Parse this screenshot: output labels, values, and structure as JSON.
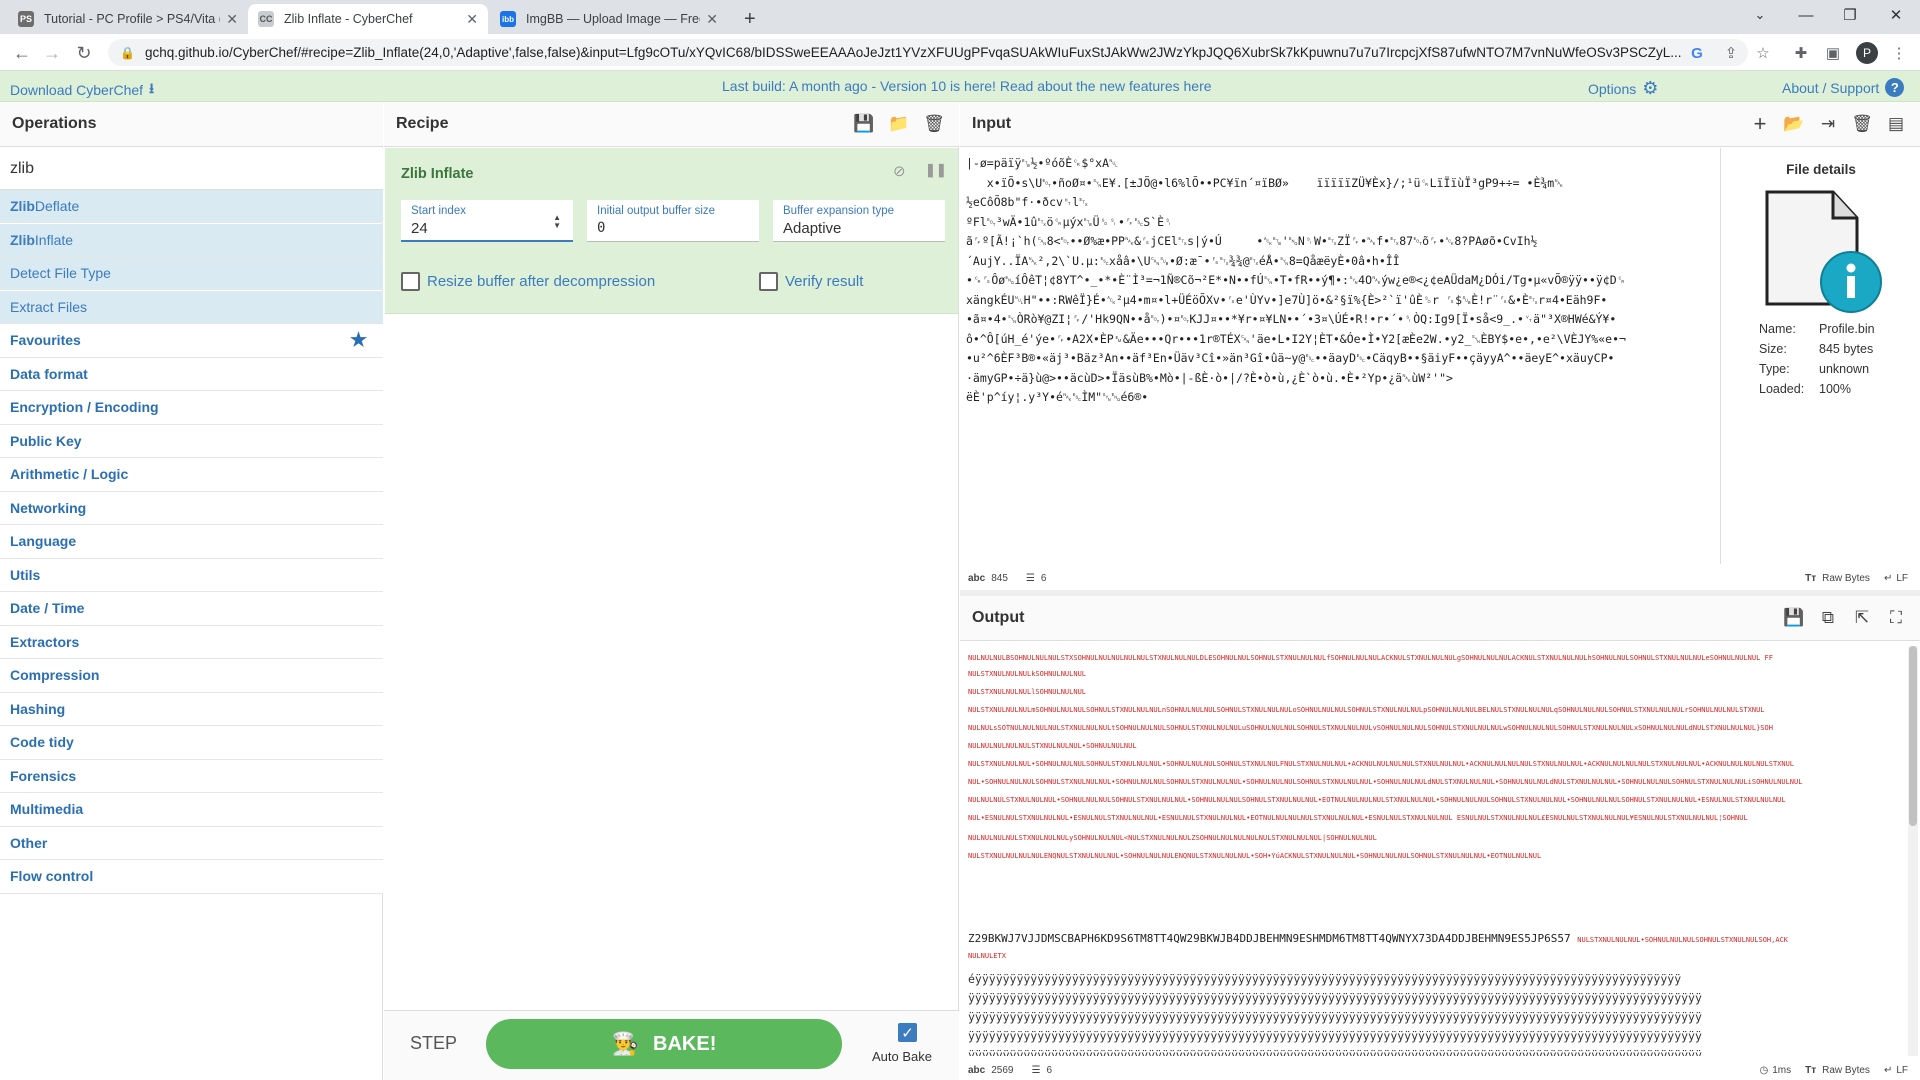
{
  "browser": {
    "tabs": [
      {
        "title": "Tutorial - PC Profile > PS4/Vita (F",
        "favicon": "PS",
        "color": "#6d6d6d"
      },
      {
        "title": "Zlib Inflate - CyberChef",
        "favicon": "CC",
        "color": "#9aa0a6"
      },
      {
        "title": "ImgBB — Upload Image — Free",
        "favicon": "ibb",
        "color": "#1a73e8"
      }
    ],
    "url": "gchq.github.io/CyberChef/#recipe=Zlib_Inflate(24,0,'Adaptive',false,false)&input=Lfg9cOTu/xYQvIC68/bIDSSweEEAAAoJeJzt1YVzXFUUgPFvqaSUAkWIuFuxStJAkWw2JWzYkpJQQ6XubrSk7kKpuwnu7u7u7IrcpcjXfS87ufwNTO7M7vnNuWfeOSv3PSCZyL...",
    "avatar": "P"
  },
  "banner": {
    "download": "Download CyberChef",
    "center": "Last build: A month ago - Version 10 is here! Read about the new features here",
    "options": "Options",
    "about": "About / Support"
  },
  "operations": {
    "title": "Operations",
    "search_value": "zlib",
    "results": [
      {
        "bold": "Zlib",
        "rest": " Deflate"
      },
      {
        "bold": "Zlib",
        "rest": " Inflate"
      },
      {
        "bold": "",
        "rest": "Detect File Type"
      },
      {
        "bold": "",
        "rest": "Extract Files"
      }
    ],
    "categories": [
      "Favourites",
      "Data format",
      "Encryption / Encoding",
      "Public Key",
      "Arithmetic / Logic",
      "Networking",
      "Language",
      "Utils",
      "Date / Time",
      "Extractors",
      "Compression",
      "Hashing",
      "Code tidy",
      "Forensics",
      "Multimedia",
      "Other",
      "Flow control"
    ]
  },
  "recipe": {
    "title": "Recipe",
    "op_name": "Zlib Inflate",
    "fields": [
      {
        "label": "Start index",
        "value": "24"
      },
      {
        "label": "Initial output buffer size",
        "value": "0"
      },
      {
        "label": "Buffer expansion type",
        "value": "Adaptive"
      }
    ],
    "checkboxes": [
      {
        "label": "Resize buffer after decompression",
        "checked": false
      },
      {
        "label": "Verify result",
        "checked": false
      }
    ],
    "step": "STEP",
    "bake": "BAKE!",
    "autobake": "Auto Bake",
    "autobake_checked": true
  },
  "input": {
    "title": "Input",
    "lines": [
      "|-ø=päïÿ␗½•ºóõÈ␍$°xA␀",
      "   x•ïÕ•s\\U␄•ñoØ¤•␖E¥.[±JÕ@•l6%lÕ••PC¥ïn´¤ïBØ»    ïïïïïZÜ¥Èx}/;¹ü␍LïÏïùÏ³gP9+÷= •È¾m␕",
      "½eCôÕ8b\"f·•ðcv␉l␃",
      "ºFl␄³wÄ•1û␃ö␍µýx␗Ü␎␏•␌␛S`È␏",
      "ã␌º[Ã!¡`h(␘8<␄••Ø%æ•PP␕&␜jCEl␃s|ý•Ú     •␆␗'␅N␏W•␃ZÏ␌•␕f•␃87␄õ␌•␆8?PAøõ•CvIh½",
      "´AujY..ÏA␕²,2\\`U.µ:␛xåâ•\\U␘␚•Ø:æ¯•␜␃¾¾@␃éÅ•␖8=QåæëyÈ•0â•h•ÎÎ",
      "•␍␜Ôø␅íÔêT¦¢8YT^•_•*•È¨Ì³=¬1Ñ®Cõ¬²E*•N••fÚ␖•T•fR••ý¶•:␖4O␕ýw¿e®<¿¢eAÜdaM¿DÓi/Tg•µ«vÕ®ÿÿ••ÿ¢D␍",
      "xängkÉU␀H\"••:RWêÏ}É•␆²µ4•m¤•l+ÜÉöÕXv•␜e'ÙYv•]e7Ù]ö•&²§ï%{È>²`ï'ûÈ␎r ␜$␚È!r¨␜&•È␃r¤4•Eäh9F•",
      "•ã¤•4•␖ÒRò¥@ZI¦␌/'Hk9QN••å␄)•¤␄KJJ¤••*¥r•¤¥LN••´•3¤\\ÚÉ•R!•r•´•␏ÒQ:Ig9[Ï•så<9_.•␋ä\"³X®HWé&Ý¥•",
      "ô•^Ô[úH_é'ýe•␌•A2X•ÈP␙&Äe•••Qr•••1r®TÉX␘'äe•L•I2Y¦ÈT•&Óe•Ì•Y2[æÈe2W.•y2_␖ÈBY$•e•,•e²\\VÈJY%«e•¬",
      "•u²^6ÈF³B®•«äj³•Bäz³An••äf³En•Üäv³Cî•»än³Gî•ûä~y@␛••äayD␛•CäqyB••§äiyF••çäyyA^••äeyE^•xäuyCP•",
      "·ämyGP•÷ä}ù@>••äcùD>•ÏäsùB%•Mò•|-ßÈ·ò•|/?È•ò•ù,¿È`ò•ù.•È•²Yp•¿ä␕ùW²'\">",
      "ëÈ'p^íy¦.y³Y•é␕␛ÌM\"␖␅é6®•"
    ],
    "file_details_title": "File details",
    "details": [
      {
        "k": "Name:",
        "v": "Profile.bin"
      },
      {
        "k": "Size:",
        "v": "845 bytes"
      },
      {
        "k": "Type:",
        "v": "unknown"
      },
      {
        "k": "Loaded:",
        "v": "100%"
      }
    ],
    "status_chars": "845",
    "status_lines": "6",
    "encoding": "Raw Bytes",
    "eol": "LF"
  },
  "output": {
    "title": "Output",
    "null_lines": [
      "NULNULNULBSOHNULNULNULSTXSOHNULNULNULNULNULSTXNULNULNULDLESOHNULNULSOHNULSTXNULNULNULfSOHNULNULNULACKNULSTXNULNULNULgSOHNULNULNULACKNULSTXNULNULNULhSOHNULNULSOHNULSTXNULNULNULeSOHNULNULNUL FF",
      "NULSTXNULNULNULkSOHNULNULNUL",
      "NULSTXNULNULNULlSOHNULNULNUL",
      "NULSTXNULNULNULmSOHNULNULNULSOHNULSTXNULNULNULnSOHNULNULNULSOHNULSTXNULNULNULoSOHNULNULNULSOHNULSTXNULNULNULpSOHNULNULNULBELNULSTXNULNULNULqSOHNULNULNULSOHNULSTXNULNULNULrSOHNULNULNULSTXNUL",
      "NULNULsSOTNULNULNULNULSTXNULNULNULtSOHNULNULNULSOHNULSTXNULNULNULuSOHNULNULNULSOHNULSTXNULNULNULvSOHNULNULNULSOHNULSTXNULNULNULwSOHNULNULNULSOHNULSTXNULNULNULxSOHNULNULNULdNULSTXNULNULNUL}SOH",
      "NULNULNULNULNULSTXNULNULNUL•SOHNULNULNUL",
      "NULSTXNULNULNUL•SOHNULNULNULSOHNULSTXNULNULNUL•SOHNULNULNULSOHNULSTXNULNULFNULSTXNULNULNUL•ACKNULNULNULNULSTXNULNULNUL•ACKNULNULNULNULSTXNULNULNUL•ACKNULNULNULNULSTXNULNULNUL•ACKNULNULNULNULSTXNUL",
      "NUL•SOHNULNULNULSOHNULSTXNULNULNUL•SOHNULNULNULSOHNULSTXNULNULNUL•SOHNULNULNULSOHNULSTXNULNULNUL•SOHNULNULNULdNULSTXNULNULNUL•SOHNULNULNULdNULSTXNULNULNUL•SOHNULNULNULSOHNULSTXNULNULNULiSOHNULNULNUL",
      "NULNULNULSTXNULNULNUL•SOHNULNULNULSOHNULSTXNULNULNUL•SOHNULNULNULSOHNULSTXNULNULNUL•EOTNULNULNULNULSTXNULNULNUL•SOHNULNULNULSOHNULSTXNULNULNUL•SOHNULNULNULSOHNULSTXNULNULNUL•ESNULNULSTXNULNULNUL",
      "NUL•ESNULNULSTXNULNULNUL•ESNULNULSTXNULNULNUL•ESNULNULSTXNULNULNUL•EOTNULNULNULNULSTXNULNULNUL•ESNULNULSTXNULNULNUL  ESNULNULSTXNULNULNUL£ESNULNULSTXNULNULNUL¥ESNULNULSTXNULNULNUL¦SOHNUL",
      "NULNULNULNULSTXNULNULNULySOHNULNULNUL<NULSTXNULNULNULZSOHNULNULNULNULNULSTXNULNULNUL|SOHNULNULNUL",
      "NULSTXNULNULNULNULENQNULSTXNULNULNUL•SOHNULNULNULENQNULSTXNULNULNUL•SOH•ÝúACKNULSTXNULNULNUL•SOHNULNULNULSOHNULSTXNULNULNUL•EOTNULNULNUL"
    ],
    "base32_line": "Z29BKWJ7VJJDMSCBAPH6KD9S6TM8TT4QW29BKWJB4DDJBEHMN9ESHMDM6TM8TT4QWNYX73DA4DDJBEHMN9ES5JP6S57",
    "base32_tail": "NULSTXNULNULNUL•SOHNULNULNULSOHNULSTXNULNULSOH,ACK",
    "base32_tail2": "NULNULETX",
    "fill_char_line": "éÿÿÿÿÿÿÿÿÿÿÿÿÿÿÿÿÿÿÿÿÿÿÿÿÿÿÿÿÿÿÿÿÿÿÿÿÿÿÿÿÿÿÿÿÿÿÿÿÿÿÿÿÿÿÿÿÿÿÿÿÿÿÿÿÿÿÿÿÿÿÿÿÿÿÿÿÿÿÿÿÿÿÿÿÿÿÿÿÿÿÿÿÿÿÿÿÿÿÿÿÿÿ",
    "fill_lines": [
      "ÿÿÿÿÿÿÿÿÿÿÿÿÿÿÿÿÿÿÿÿÿÿÿÿÿÿÿÿÿÿÿÿÿÿÿÿÿÿÿÿÿÿÿÿÿÿÿÿÿÿÿÿÿÿÿÿÿÿÿÿÿÿÿÿÿÿÿÿÿÿÿÿÿÿÿÿÿÿÿÿÿÿÿÿÿÿÿÿÿÿÿÿÿÿÿÿÿÿÿÿÿÿÿÿÿÿ",
      "ÿÿÿÿÿÿÿÿÿÿÿÿÿÿÿÿÿÿÿÿÿÿÿÿÿÿÿÿÿÿÿÿÿÿÿÿÿÿÿÿÿÿÿÿÿÿÿÿÿÿÿÿÿÿÿÿÿÿÿÿÿÿÿÿÿÿÿÿÿÿÿÿÿÿÿÿÿÿÿÿÿÿÿÿÿÿÿÿÿÿÿÿÿÿÿÿÿÿÿÿÿÿÿÿÿÿ",
      "ÿÿÿÿÿÿÿÿÿÿÿÿÿÿÿÿÿÿÿÿÿÿÿÿÿÿÿÿÿÿÿÿÿÿÿÿÿÿÿÿÿÿÿÿÿÿÿÿÿÿÿÿÿÿÿÿÿÿÿÿÿÿÿÿÿÿÿÿÿÿÿÿÿÿÿÿÿÿÿÿÿÿÿÿÿÿÿÿÿÿÿÿÿÿÿÿÿÿÿÿÿÿÿÿÿÿ",
      "ÿÿÿÿÿÿÿÿÿÿÿÿÿÿÿÿÿÿÿÿÿÿÿÿÿÿÿÿÿÿÿÿÿÿÿÿÿÿÿÿÿÿÿÿÿÿÿÿÿÿÿÿÿÿÿÿÿÿÿÿÿÿÿÿÿÿÿÿÿÿÿÿÿÿÿÿÿÿÿÿÿÿÿÿÿÿÿÿÿÿÿÿÿÿÿÿÿÿÿÿÿÿÿÿÿÿ",
      "ÿÿÿÿÿÿÿÿÿÿÿÿÿÿÿÿÿÿÿÿÿÿÿÿÿÿÿÿÿÿÿÿÿÿÿÿÿÿÿÿÿÿÿÿÿÿÿÿÿÿÿÿÿÿÿÿÿÿÿÿÿÿÿÿÿÿÿÿÿÿÿÿÿÿÿÿÿÿÿÿÿÿÿÿÿÿÿÿÿÿÿÿÿÿÿÿÿÿÿÿÿÿÿÿÿÿ",
      "ÿÿÿÿÿÿÿÿÿÿÿÿÿÿÿÿÿÿÿÿÿÿÿÿÿÿÿÿÿÿÿÿÿÿÿÿÿÿÿÿÿÿÿÿÿÿÿÿÿÿÿÿÿÿÿÿÿÿÿÿÿÿÿÿÿÿÿÿÿÿÿÿÿÿÿÿÿÿÿÿÿÿÿÿÿÿÿÿÿÿÿÿÿÿÿÿÿÿÿÿÿÿÿÿÿÿ"
    ],
    "status_chars": "2569",
    "status_lines": "6",
    "time": "1ms",
    "encoding": "Raw Bytes",
    "eol": "LF"
  },
  "colors": {
    "accent": "#3b7bbf",
    "bake": "#5cb85c",
    "banner_bg": "#dff0d8",
    "recipe_op_bg": "#dff0d8",
    "control_char": "#dd2222"
  }
}
